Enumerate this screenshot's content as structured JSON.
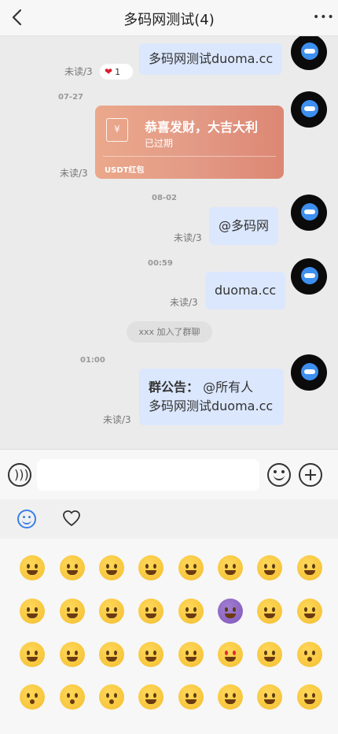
{
  "header": {
    "title": "多码网测试(4)",
    "more_label": "•••"
  },
  "messages": {
    "m1_text": "多码网测试duoma.cc",
    "m1_unread": "未读/3",
    "m1_reaction_count": "1",
    "time_1": "07-27",
    "redpack_title": "恭喜发财，大吉大利",
    "redpack_status": "已过期",
    "redpack_type": "USDT红包",
    "redpack_unread": "未读/3",
    "time_2": "08-02",
    "m2_text": "@多码网",
    "m2_unread": "未读/3",
    "time_3": "00:59",
    "m3_text": "duoma.cc",
    "m3_unread": "未读/3",
    "system_notice": "xxx 加入了群聊",
    "time_4": "01:00",
    "notice_label": "群公告：",
    "notice_mention": "@所有人",
    "notice_text": "多码网测试duoma.cc",
    "notice_unread": "未读/3"
  },
  "input": {
    "placeholder": "",
    "value": ""
  },
  "emoji_panel": {
    "tabs": [
      "emoji-icon",
      "heart-icon"
    ],
    "selected_tab": "emoji",
    "rows": [
      [
        "smiley-icon",
        "grimacing-icon",
        "grin-icon",
        "joy-icon",
        "rofl-icon",
        "partying-face-icon",
        "woozy-face-icon",
        "pleading-face-icon"
      ],
      [
        "smiley-big-eyes-icon",
        "grinning-squinting-icon",
        "grin-sweat-icon",
        "laughing-icon",
        "innocent-halo-icon",
        "smiling-imp-icon",
        "winking-icon",
        "blushing-icon"
      ],
      [
        "slight-smile-icon",
        "upside-down-icon",
        "smiling-hearts-cheeks-icon",
        "yum-icon",
        "relieved-icon",
        "heart-eyes-icon",
        "smiling-face-hearts-icon",
        "kissing-heart-icon"
      ],
      [
        "kissing-icon",
        "kissing-smiling-eyes-icon",
        "kissing-closed-eyes-icon",
        "winking-tongue-icon",
        "zany-face-icon",
        "raised-eyebrow-icon",
        "monocle-face-icon",
        "squinting-tongue-icon"
      ]
    ]
  },
  "colors": {
    "bubble": "#dbe7fd",
    "accent": "#3b7fe6",
    "redpack": "#e39b86"
  }
}
